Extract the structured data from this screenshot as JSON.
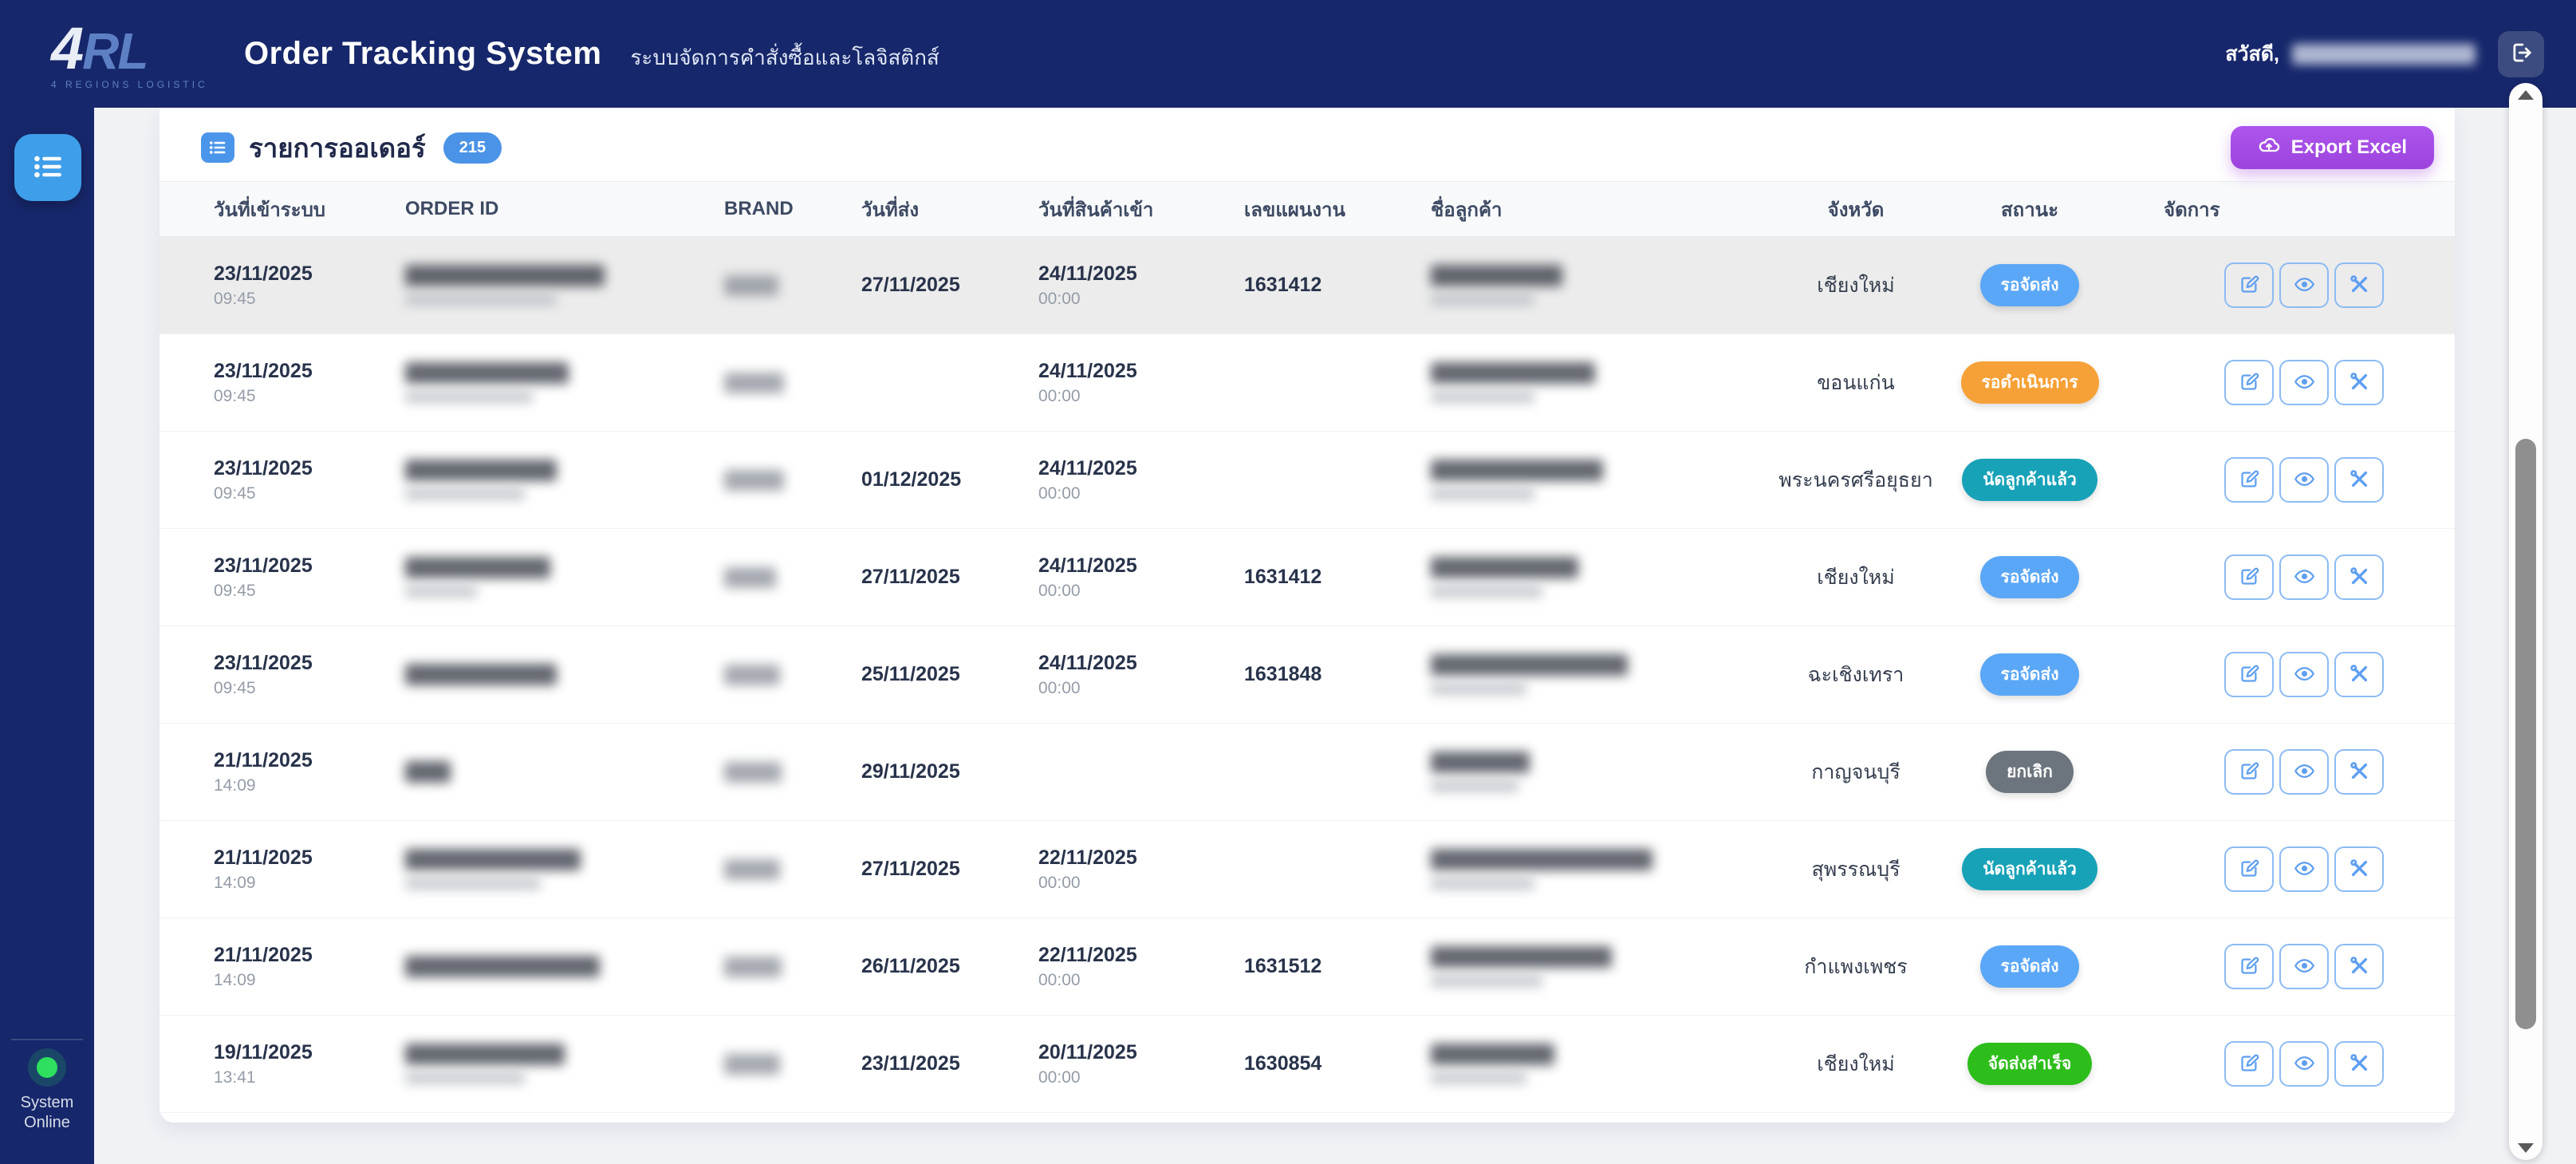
{
  "header": {
    "logo_text": "4RL",
    "logo_sub": "4 REGIONS LOGISTIC",
    "title": "Order Tracking System",
    "subtitle": "ระบบจัดการคำสั่งซื้อและโลจิสติกส์",
    "greeting": "สวัสดี,"
  },
  "sidebar": {
    "system_status": "System Online",
    "system_status_line1": "System",
    "system_status_line2": "Online"
  },
  "panel": {
    "title": "รายการออเดอร์",
    "count_badge": "215",
    "export_label": "Export Excel"
  },
  "colors": {
    "navy": "#17276b",
    "accent_blue": "#3f9ee9",
    "badge_blue": "#4b93e7",
    "export_purple": "#A64FE3",
    "online_green": "#2ee05e",
    "status_waiting_ship": "#5BA7F7",
    "status_pending": "#F6A137",
    "status_appointment": "#17A2B8",
    "status_cancelled": "#6C757D",
    "status_delivered": "#2DBE1B"
  },
  "table": {
    "columns": [
      "วันที่เข้าระบบ",
      "ORDER ID",
      "BRAND",
      "วันที่ส่ง",
      "วันที่สินค้าเข้า",
      "เลขแผนงาน",
      "ชื่อลูกค้า",
      "จังหวัด",
      "สถานะ",
      "จัดการ"
    ],
    "rows": [
      {
        "date": "23/11/2025",
        "time": "09:45",
        "ship": "27/11/2025",
        "arrive": "24/11/2025",
        "arrive_time": "00:00",
        "plan": "1631412",
        "province": "เชียงใหม่",
        "status": "รอจัดส่ง",
        "status_color": "#5BA7F7",
        "highlighted": true,
        "order_w": 250,
        "order_w2": 190,
        "brand_w": 68,
        "cust_w": 165,
        "cust_w2": 130
      },
      {
        "date": "23/11/2025",
        "time": "09:45",
        "ship": "",
        "arrive": "24/11/2025",
        "arrive_time": "00:00",
        "plan": "",
        "province": "ขอนแก่น",
        "status": "รอดำเนินการ",
        "status_color": "#F6A137",
        "highlighted": false,
        "order_w": 205,
        "order_w2": 160,
        "brand_w": 75,
        "cust_w": 206,
        "cust_w2": 130
      },
      {
        "date": "23/11/2025",
        "time": "09:45",
        "ship": "01/12/2025",
        "arrive": "24/11/2025",
        "arrive_time": "00:00",
        "plan": "",
        "province": "พระนครศรีอยุธยา",
        "status": "นัดลูกค้าแล้ว",
        "status_color": "#17A2B8",
        "highlighted": false,
        "order_w": 190,
        "order_w2": 150,
        "brand_w": 75,
        "cust_w": 216,
        "cust_w2": 130
      },
      {
        "date": "23/11/2025",
        "time": "09:45",
        "ship": "27/11/2025",
        "arrive": "24/11/2025",
        "arrive_time": "00:00",
        "plan": "1631412",
        "province": "เชียงใหม่",
        "status": "รอจัดส่ง",
        "status_color": "#5BA7F7",
        "highlighted": false,
        "order_w": 182,
        "order_w2": 90,
        "brand_w": 65,
        "cust_w": 185,
        "cust_w2": 140
      },
      {
        "date": "23/11/2025",
        "time": "09:45",
        "ship": "25/11/2025",
        "arrive": "24/11/2025",
        "arrive_time": "00:00",
        "plan": "1631848",
        "province": "ฉะเชิงเทรา",
        "status": "รอจัดส่ง",
        "status_color": "#5BA7F7",
        "highlighted": false,
        "order_w": 190,
        "order_w2": 0,
        "brand_w": 70,
        "cust_w": 247,
        "cust_w2": 120
      },
      {
        "date": "21/11/2025",
        "time": "14:09",
        "ship": "29/11/2025",
        "arrive": "",
        "arrive_time": "",
        "plan": "",
        "province": "กาญจนบุรี",
        "status": "ยกเลิก",
        "status_color": "#6C757D",
        "highlighted": false,
        "order_w": 57,
        "order_w2": 0,
        "brand_w": 72,
        "cust_w": 124,
        "cust_w2": 110
      },
      {
        "date": "21/11/2025",
        "time": "14:09",
        "ship": "27/11/2025",
        "arrive": "22/11/2025",
        "arrive_time": "00:00",
        "plan": "",
        "province": "สุพรรณบุรี",
        "status": "นัดลูกค้าแล้ว",
        "status_color": "#17A2B8",
        "highlighted": false,
        "order_w": 220,
        "order_w2": 170,
        "brand_w": 70,
        "cust_w": 278,
        "cust_w2": 130
      },
      {
        "date": "21/11/2025",
        "time": "14:09",
        "ship": "26/11/2025",
        "arrive": "22/11/2025",
        "arrive_time": "00:00",
        "plan": "1631512",
        "province": "กำแพงเพชร",
        "status": "รอจัดส่ง",
        "status_color": "#5BA7F7",
        "highlighted": false,
        "order_w": 244,
        "order_w2": 0,
        "brand_w": 72,
        "cust_w": 227,
        "cust_w2": 140
      },
      {
        "date": "19/11/2025",
        "time": "13:41",
        "ship": "23/11/2025",
        "arrive": "20/11/2025",
        "arrive_time": "00:00",
        "plan": "1630854",
        "province": "เชียงใหม่",
        "status": "จัดส่งสำเร็จ",
        "status_color": "#2DBE1B",
        "highlighted": false,
        "order_w": 200,
        "order_w2": 150,
        "brand_w": 70,
        "cust_w": 155,
        "cust_w2": 120
      }
    ]
  }
}
